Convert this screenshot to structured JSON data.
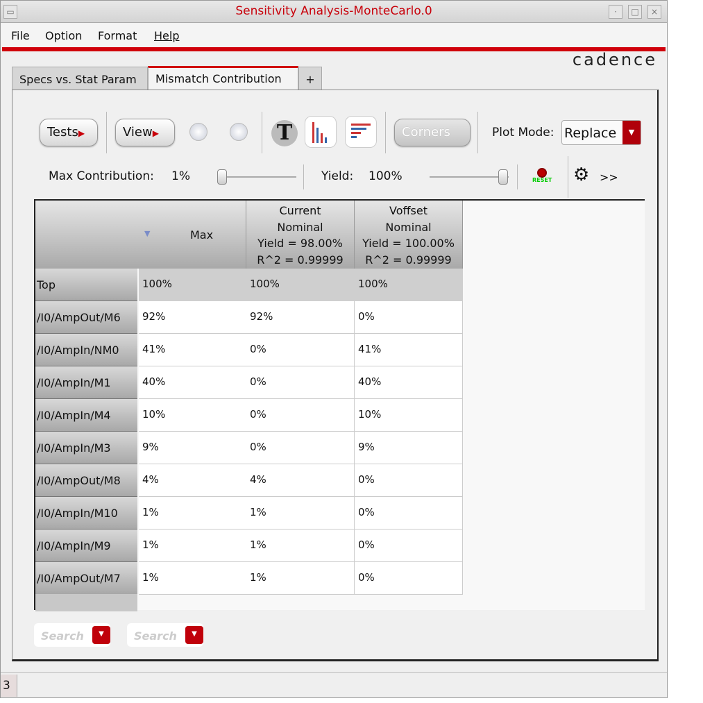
{
  "window": {
    "title": "Sensitivity Analysis-MonteCarlo.0"
  },
  "menu": [
    "File",
    "Option",
    "Format",
    "Help"
  ],
  "logo": "cadence",
  "tabs": [
    {
      "label": "Specs vs. Stat Param"
    },
    {
      "label": "Mismatch Contribution"
    },
    {
      "label": "+"
    }
  ],
  "toolbar": {
    "tests": "Tests",
    "view": "View",
    "corners": "Corners",
    "plot_mode_label": "Plot Mode:",
    "plot_mode_value": "Replace",
    "text_icon": "T"
  },
  "sliders": {
    "max_contribution_label": "Max Contribution:",
    "max_contribution_value": "1%",
    "yield_label": "Yield:",
    "yield_value": "100%",
    "reset": "RESET",
    "more": ">>"
  },
  "table": {
    "headers": [
      "Max",
      [
        "Current",
        "Nominal",
        "Yield = 98.00%",
        "R^2 = 0.99999"
      ],
      [
        "Voffset",
        "Nominal",
        "Yield = 100.00%",
        "R^2 = 0.99999"
      ]
    ],
    "rows": [
      {
        "name": "Top",
        "values": [
          "100%",
          "100%",
          "100%"
        ]
      },
      {
        "name": "/I0/AmpOut/M6",
        "values": [
          "92%",
          "92%",
          "0%"
        ]
      },
      {
        "name": "/I0/AmpIn/NM0",
        "values": [
          "41%",
          "0%",
          "41%"
        ]
      },
      {
        "name": "/I0/AmpIn/M1",
        "values": [
          "40%",
          "0%",
          "40%"
        ]
      },
      {
        "name": "/I0/AmpIn/M4",
        "values": [
          "10%",
          "0%",
          "10%"
        ]
      },
      {
        "name": "/I0/AmpIn/M3",
        "values": [
          "9%",
          "0%",
          "9%"
        ]
      },
      {
        "name": "/I0/AmpOut/M8",
        "values": [
          "4%",
          "4%",
          "0%"
        ]
      },
      {
        "name": "/I0/AmpIn/M10",
        "values": [
          "1%",
          "1%",
          "0%"
        ]
      },
      {
        "name": "/I0/AmpIn/M9",
        "values": [
          "1%",
          "1%",
          "0%"
        ]
      },
      {
        "name": "/I0/AmpOut/M7",
        "values": [
          "1%",
          "1%",
          "0%"
        ]
      }
    ]
  },
  "search": [
    "Search",
    "Search"
  ],
  "status": "3",
  "colors": {
    "accent": "#d0000a"
  }
}
